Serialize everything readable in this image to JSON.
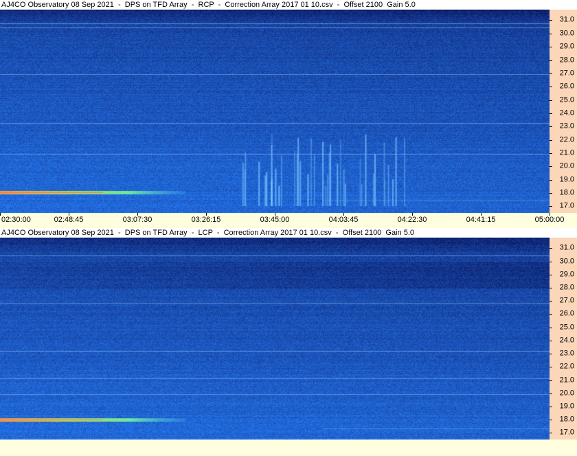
{
  "chart_data": [
    {
      "type": "heatmap",
      "title": "AJ4CO Observatory 08 Sep 2021  -  DPS on TFD Array  -  RCP  -  Correction Array 2017 01 10.csv  -  Offset 2100  Gain 5.0",
      "y_ticks": [
        "31.0",
        "30.0",
        "29.0",
        "28.0",
        "27.0",
        "26.0",
        "25.0",
        "24.0",
        "23.0",
        "22.0",
        "21.0",
        "20.0",
        "19.0",
        "18.0",
        "17.0"
      ],
      "y_range_mhz": [
        16.5,
        31.8
      ],
      "x_ticks": [
        "02:30:00",
        "02:48:45",
        "03:07:30",
        "03:26:15",
        "03:45:00",
        "04:03:45",
        "04:22:30",
        "04:41:15",
        "05:00:00"
      ],
      "x_range": [
        "02:30:00",
        "05:00:00"
      ]
    },
    {
      "type": "heatmap",
      "title": "AJ4CO Observatory 08 Sep 2021  -  DPS on TFD Array  -  LCP  -  Correction Array 2017 01 10.csv  -  Offset 2100  Gain 5.0",
      "y_ticks": [
        "31.0",
        "30.0",
        "29.0",
        "28.0",
        "27.0",
        "26.0",
        "25.0",
        "24.0",
        "23.0",
        "22.0",
        "21.0",
        "20.0",
        "19.0",
        "18.0",
        "17.0"
      ],
      "y_range_mhz": [
        16.5,
        31.8
      ],
      "x_range": [
        "02:30:00",
        "05:00:00"
      ]
    }
  ],
  "colors": {
    "background_dark": "#0a1a6e",
    "background_mid": "#1e4fd8",
    "axis_panel": "#fbd6b9",
    "time_bar": "#ffffe0"
  }
}
